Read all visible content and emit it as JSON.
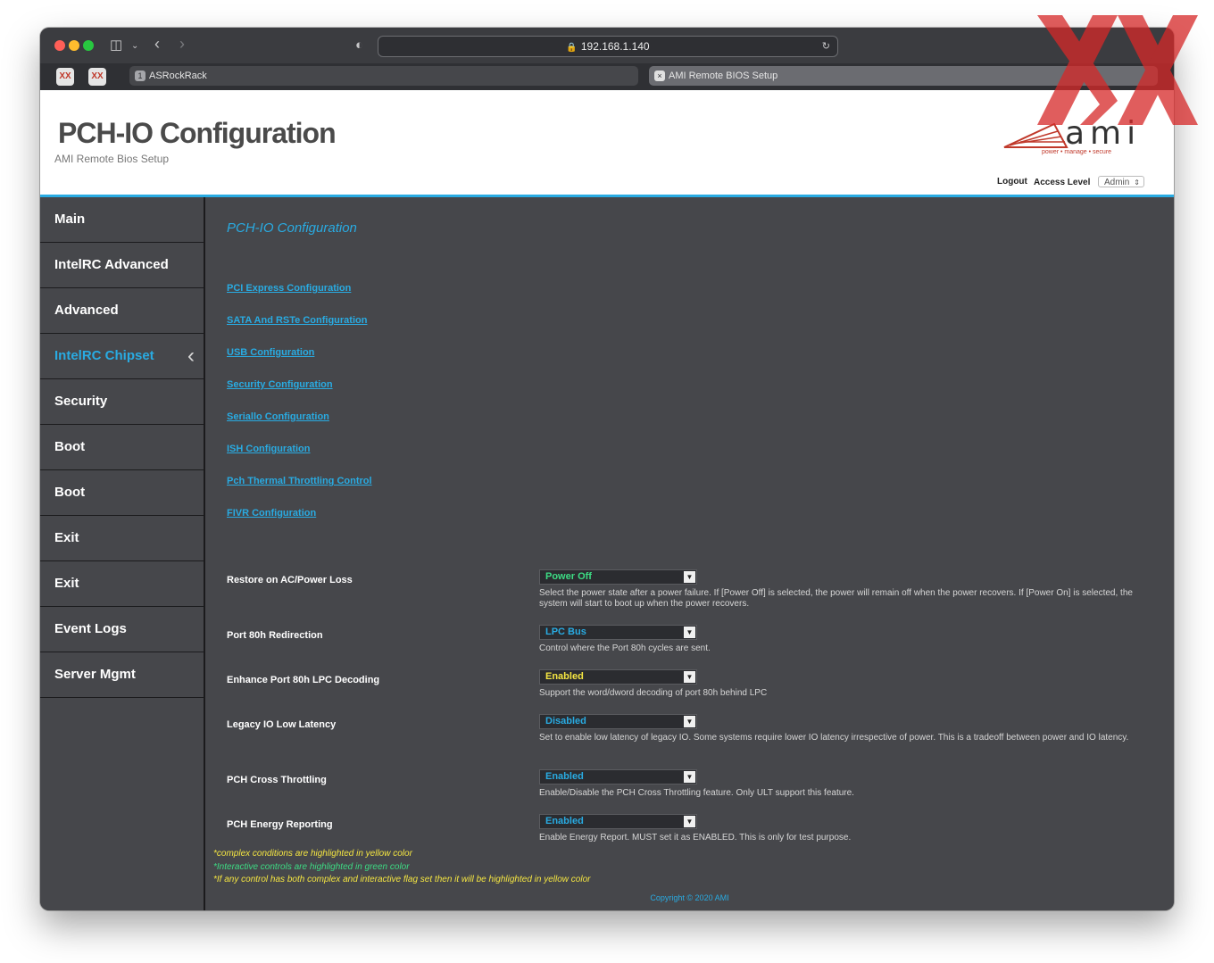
{
  "browser": {
    "address": "192.168.1.140",
    "tabs": [
      {
        "label": "ASRockRack",
        "badge": "1"
      },
      {
        "label": "AMI Remote BIOS Setup"
      }
    ]
  },
  "header": {
    "title": "PCH-IO Configuration",
    "subtitle": "AMI Remote Bios Setup",
    "logo_text": "ami",
    "logo_tagline": "power • manage • secure",
    "logout_label": "Logout",
    "access_level_label": "Access Level",
    "access_level_value": "Admin"
  },
  "sidebar": {
    "items": [
      {
        "label": "Main"
      },
      {
        "label": "IntelRC Advanced"
      },
      {
        "label": "Advanced"
      },
      {
        "label": "IntelRC Chipset",
        "active": true
      },
      {
        "label": "Security"
      },
      {
        "label": "Boot"
      },
      {
        "label": "Boot"
      },
      {
        "label": "Exit"
      },
      {
        "label": "Exit"
      },
      {
        "label": "Event Logs"
      },
      {
        "label": "Server Mgmt"
      }
    ]
  },
  "main": {
    "section_title": "PCH-IO Configuration",
    "links": [
      "PCI Express Configuration",
      "SATA And RSTe Configuration",
      "USB Configuration",
      "Security Configuration",
      "Seriallo Configuration",
      "ISH Configuration",
      "Pch Thermal Throttling Control",
      "FIVR Configuration"
    ],
    "settings": [
      {
        "label": "Restore on AC/Power Loss",
        "value": "Power Off",
        "help": "Select the power state after a power failure. If [Power Off] is selected, the power will remain off when the power recovers. If [Power On] is selected, the system will start to boot up when the power recovers."
      },
      {
        "label": "Port 80h Redirection",
        "value": "LPC Bus",
        "help": "Control where the Port 80h cycles are sent."
      },
      {
        "label": "Enhance Port 80h LPC Decoding",
        "value": "Enabled",
        "help": "Support the word/dword decoding of port 80h behind LPC"
      },
      {
        "label": "Legacy IO Low Latency",
        "value": "Disabled",
        "help": "Set to enable low latency of legacy IO. Some systems require lower IO latency irrespective of power. This is a tradeoff between power and IO latency."
      },
      {
        "label": "PCH Cross Throttling",
        "value": "Enabled",
        "help": "Enable/Disable the PCH Cross Throttling feature. Only ULT support this feature."
      },
      {
        "label": "PCH Energy Reporting",
        "value": "Enabled",
        "help": "Enable Energy Report. MUST set it as ENABLED. This is only for test purpose."
      }
    ],
    "notes": [
      "*complex conditions are highlighted in yellow color",
      "*Interactive controls are highlighted in green color",
      "*If any control has both complex and interactive flag set then it will be highlighted in yellow color"
    ],
    "copyright": "Copyright © 2020 AMI"
  },
  "colors": {
    "accent": "#29abe2",
    "interactive": "#3ddc84",
    "complex": "#f5e642",
    "background": "#46474b"
  },
  "icons": {
    "toolbar": [
      "sidebar-toggle-icon",
      "back-icon",
      "forward-icon",
      "shield-icon",
      "lock-icon",
      "translate-icon",
      "reload-icon"
    ],
    "sidebar_active": "chevron-left-icon",
    "select": "dropdown-arrow-icon"
  }
}
